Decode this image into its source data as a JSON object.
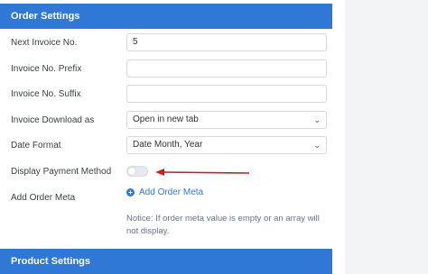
{
  "order_settings": {
    "title": "Order Settings",
    "next_invoice_label": "Next Invoice No.",
    "next_invoice_value": "5",
    "prefix_label": "Invoice No. Prefix",
    "prefix_value": "",
    "suffix_label": "Invoice No. Suffix",
    "suffix_value": "",
    "download_label": "Invoice Download as",
    "download_value": "Open in new tab",
    "date_format_label": "Date Format",
    "date_format_value": "Date Month, Year",
    "payment_method_label": "Display Payment Method",
    "payment_method_enabled": false,
    "order_meta_label": "Add Order Meta",
    "add_order_meta_button": "Add Order Meta",
    "notice": "Notice: If order meta value is empty or an array will not display."
  },
  "product_settings": {
    "title": "Product Settings"
  },
  "colors": {
    "accent": "#2f78d6",
    "arrow": "#d11a1a"
  }
}
